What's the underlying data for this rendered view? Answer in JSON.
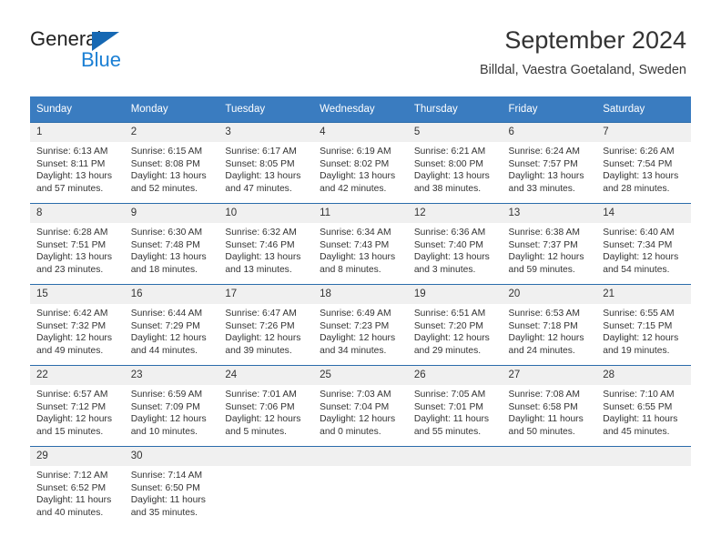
{
  "brand": {
    "name_part1": "General",
    "name_part2": "Blue",
    "triangle_icon": "brand-triangle-icon",
    "colors": {
      "blue": "#1a7fd4",
      "dark": "#222222"
    }
  },
  "header": {
    "title": "September 2024",
    "subtitle": "Billdal, Vaestra Goetaland, Sweden"
  },
  "theme": {
    "header_bg": "#3a7cc0",
    "row_divider": "#2b6cab",
    "daynum_bg": "#f0f0f0"
  },
  "calendar": {
    "weekday_headers": [
      "Sunday",
      "Monday",
      "Tuesday",
      "Wednesday",
      "Thursday",
      "Friday",
      "Saturday"
    ],
    "weeks": [
      [
        {
          "day": "1",
          "sunrise": "Sunrise: 6:13 AM",
          "sunset": "Sunset: 8:11 PM",
          "daylight_line1": "Daylight: 13 hours",
          "daylight_line2": "and 57 minutes."
        },
        {
          "day": "2",
          "sunrise": "Sunrise: 6:15 AM",
          "sunset": "Sunset: 8:08 PM",
          "daylight_line1": "Daylight: 13 hours",
          "daylight_line2": "and 52 minutes."
        },
        {
          "day": "3",
          "sunrise": "Sunrise: 6:17 AM",
          "sunset": "Sunset: 8:05 PM",
          "daylight_line1": "Daylight: 13 hours",
          "daylight_line2": "and 47 minutes."
        },
        {
          "day": "4",
          "sunrise": "Sunrise: 6:19 AM",
          "sunset": "Sunset: 8:02 PM",
          "daylight_line1": "Daylight: 13 hours",
          "daylight_line2": "and 42 minutes."
        },
        {
          "day": "5",
          "sunrise": "Sunrise: 6:21 AM",
          "sunset": "Sunset: 8:00 PM",
          "daylight_line1": "Daylight: 13 hours",
          "daylight_line2": "and 38 minutes."
        },
        {
          "day": "6",
          "sunrise": "Sunrise: 6:24 AM",
          "sunset": "Sunset: 7:57 PM",
          "daylight_line1": "Daylight: 13 hours",
          "daylight_line2": "and 33 minutes."
        },
        {
          "day": "7",
          "sunrise": "Sunrise: 6:26 AM",
          "sunset": "Sunset: 7:54 PM",
          "daylight_line1": "Daylight: 13 hours",
          "daylight_line2": "and 28 minutes."
        }
      ],
      [
        {
          "day": "8",
          "sunrise": "Sunrise: 6:28 AM",
          "sunset": "Sunset: 7:51 PM",
          "daylight_line1": "Daylight: 13 hours",
          "daylight_line2": "and 23 minutes."
        },
        {
          "day": "9",
          "sunrise": "Sunrise: 6:30 AM",
          "sunset": "Sunset: 7:48 PM",
          "daylight_line1": "Daylight: 13 hours",
          "daylight_line2": "and 18 minutes."
        },
        {
          "day": "10",
          "sunrise": "Sunrise: 6:32 AM",
          "sunset": "Sunset: 7:46 PM",
          "daylight_line1": "Daylight: 13 hours",
          "daylight_line2": "and 13 minutes."
        },
        {
          "day": "11",
          "sunrise": "Sunrise: 6:34 AM",
          "sunset": "Sunset: 7:43 PM",
          "daylight_line1": "Daylight: 13 hours",
          "daylight_line2": "and 8 minutes."
        },
        {
          "day": "12",
          "sunrise": "Sunrise: 6:36 AM",
          "sunset": "Sunset: 7:40 PM",
          "daylight_line1": "Daylight: 13 hours",
          "daylight_line2": "and 3 minutes."
        },
        {
          "day": "13",
          "sunrise": "Sunrise: 6:38 AM",
          "sunset": "Sunset: 7:37 PM",
          "daylight_line1": "Daylight: 12 hours",
          "daylight_line2": "and 59 minutes."
        },
        {
          "day": "14",
          "sunrise": "Sunrise: 6:40 AM",
          "sunset": "Sunset: 7:34 PM",
          "daylight_line1": "Daylight: 12 hours",
          "daylight_line2": "and 54 minutes."
        }
      ],
      [
        {
          "day": "15",
          "sunrise": "Sunrise: 6:42 AM",
          "sunset": "Sunset: 7:32 PM",
          "daylight_line1": "Daylight: 12 hours",
          "daylight_line2": "and 49 minutes."
        },
        {
          "day": "16",
          "sunrise": "Sunrise: 6:44 AM",
          "sunset": "Sunset: 7:29 PM",
          "daylight_line1": "Daylight: 12 hours",
          "daylight_line2": "and 44 minutes."
        },
        {
          "day": "17",
          "sunrise": "Sunrise: 6:47 AM",
          "sunset": "Sunset: 7:26 PM",
          "daylight_line1": "Daylight: 12 hours",
          "daylight_line2": "and 39 minutes."
        },
        {
          "day": "18",
          "sunrise": "Sunrise: 6:49 AM",
          "sunset": "Sunset: 7:23 PM",
          "daylight_line1": "Daylight: 12 hours",
          "daylight_line2": "and 34 minutes."
        },
        {
          "day": "19",
          "sunrise": "Sunrise: 6:51 AM",
          "sunset": "Sunset: 7:20 PM",
          "daylight_line1": "Daylight: 12 hours",
          "daylight_line2": "and 29 minutes."
        },
        {
          "day": "20",
          "sunrise": "Sunrise: 6:53 AM",
          "sunset": "Sunset: 7:18 PM",
          "daylight_line1": "Daylight: 12 hours",
          "daylight_line2": "and 24 minutes."
        },
        {
          "day": "21",
          "sunrise": "Sunrise: 6:55 AM",
          "sunset": "Sunset: 7:15 PM",
          "daylight_line1": "Daylight: 12 hours",
          "daylight_line2": "and 19 minutes."
        }
      ],
      [
        {
          "day": "22",
          "sunrise": "Sunrise: 6:57 AM",
          "sunset": "Sunset: 7:12 PM",
          "daylight_line1": "Daylight: 12 hours",
          "daylight_line2": "and 15 minutes."
        },
        {
          "day": "23",
          "sunrise": "Sunrise: 6:59 AM",
          "sunset": "Sunset: 7:09 PM",
          "daylight_line1": "Daylight: 12 hours",
          "daylight_line2": "and 10 minutes."
        },
        {
          "day": "24",
          "sunrise": "Sunrise: 7:01 AM",
          "sunset": "Sunset: 7:06 PM",
          "daylight_line1": "Daylight: 12 hours",
          "daylight_line2": "and 5 minutes."
        },
        {
          "day": "25",
          "sunrise": "Sunrise: 7:03 AM",
          "sunset": "Sunset: 7:04 PM",
          "daylight_line1": "Daylight: 12 hours",
          "daylight_line2": "and 0 minutes."
        },
        {
          "day": "26",
          "sunrise": "Sunrise: 7:05 AM",
          "sunset": "Sunset: 7:01 PM",
          "daylight_line1": "Daylight: 11 hours",
          "daylight_line2": "and 55 minutes."
        },
        {
          "day": "27",
          "sunrise": "Sunrise: 7:08 AM",
          "sunset": "Sunset: 6:58 PM",
          "daylight_line1": "Daylight: 11 hours",
          "daylight_line2": "and 50 minutes."
        },
        {
          "day": "28",
          "sunrise": "Sunrise: 7:10 AM",
          "sunset": "Sunset: 6:55 PM",
          "daylight_line1": "Daylight: 11 hours",
          "daylight_line2": "and 45 minutes."
        }
      ],
      [
        {
          "day": "29",
          "sunrise": "Sunrise: 7:12 AM",
          "sunset": "Sunset: 6:52 PM",
          "daylight_line1": "Daylight: 11 hours",
          "daylight_line2": "and 40 minutes."
        },
        {
          "day": "30",
          "sunrise": "Sunrise: 7:14 AM",
          "sunset": "Sunset: 6:50 PM",
          "daylight_line1": "Daylight: 11 hours",
          "daylight_line2": "and 35 minutes."
        },
        {
          "day": "",
          "sunrise": "",
          "sunset": "",
          "daylight_line1": "",
          "daylight_line2": ""
        },
        {
          "day": "",
          "sunrise": "",
          "sunset": "",
          "daylight_line1": "",
          "daylight_line2": ""
        },
        {
          "day": "",
          "sunrise": "",
          "sunset": "",
          "daylight_line1": "",
          "daylight_line2": ""
        },
        {
          "day": "",
          "sunrise": "",
          "sunset": "",
          "daylight_line1": "",
          "daylight_line2": ""
        },
        {
          "day": "",
          "sunrise": "",
          "sunset": "",
          "daylight_line1": "",
          "daylight_line2": ""
        }
      ]
    ]
  }
}
